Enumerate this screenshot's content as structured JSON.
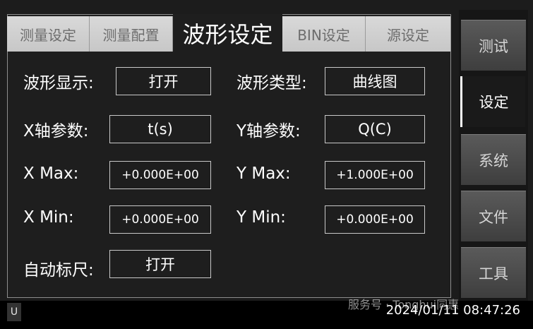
{
  "tabs": [
    "测量设定",
    "测量配置",
    "波形设定",
    "BIN设定",
    "源设定"
  ],
  "active_tab": "波形设定",
  "fields": {
    "wave_display": {
      "label": "波形显示:",
      "value": "打开"
    },
    "wave_type": {
      "label": "波形类型:",
      "value": "曲线图"
    },
    "x_param": {
      "label": "X轴参数:",
      "value": "t(s)"
    },
    "y_param": {
      "label": "Y轴参数:",
      "value": "Q(C)"
    },
    "x_max": {
      "label": "X Max:",
      "value": "+0.000E+00"
    },
    "y_max": {
      "label": "Y Max:",
      "value": "+1.000E+00"
    },
    "x_min": {
      "label": "X Min:",
      "value": "+0.000E+00"
    },
    "y_min": {
      "label": "Y Min:",
      "value": "+0.000E+00"
    },
    "auto_scale": {
      "label": "自动标尺:",
      "value": "打开"
    }
  },
  "nav": [
    "测试",
    "设定",
    "系统",
    "文件",
    "工具"
  ],
  "active_nav": "设定",
  "status": {
    "badge": "U",
    "datetime": "2024/01/11 08:47:26",
    "watermark": "服务号 · Tonghui同惠"
  }
}
